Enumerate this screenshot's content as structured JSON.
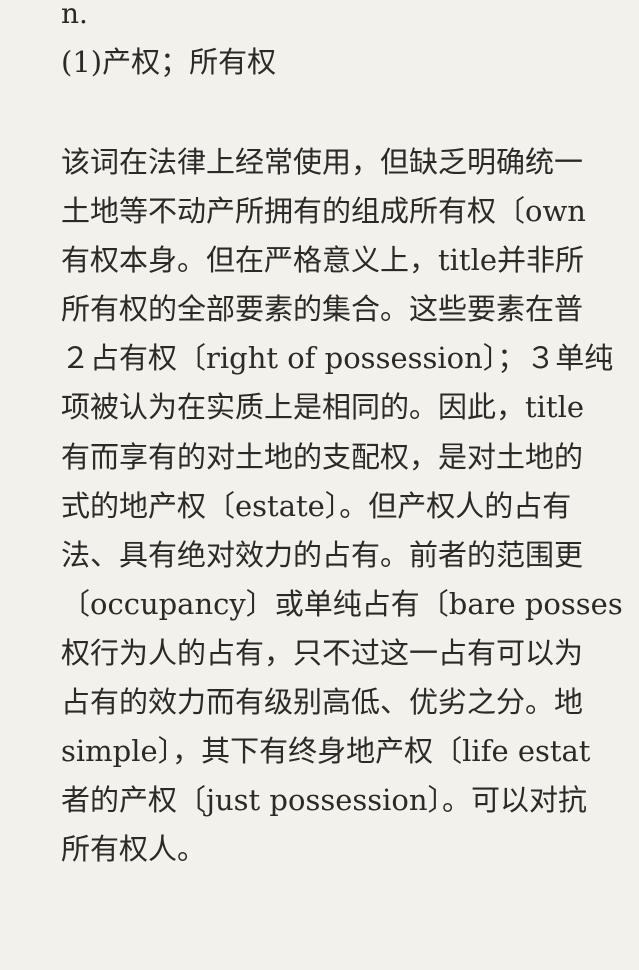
{
  "entry": {
    "pos": "n.",
    "sense": "(1)产权；所有权",
    "lines": [
      "该词在法律上经常使用，但缺乏明确统一",
      "土地等不动产所拥有的组成所有权〔own",
      "有权本身。但在严格意义上，title并非所",
      "所有权的全部要素的集合。这些要素在普",
      "２占有权〔right of possession〕；３单纯",
      "项被认为在实质上是相同的。因此，title",
      "有而享有的对土地的支配权，是对土地的",
      "式的地产权〔estate〕。但产权人的占有",
      "法、具有绝对效力的占有。前者的范围更",
      "〔occupancy〕或单纯占有〔bare posses",
      "权行为人的占有，只不过这一占有可以为",
      "占有的效力而有级别高低、优劣之分。地",
      "simple〕，其下有终身地产权〔life estat",
      "者的产权〔just possession〕。可以对抗",
      "所有权人。"
    ]
  }
}
